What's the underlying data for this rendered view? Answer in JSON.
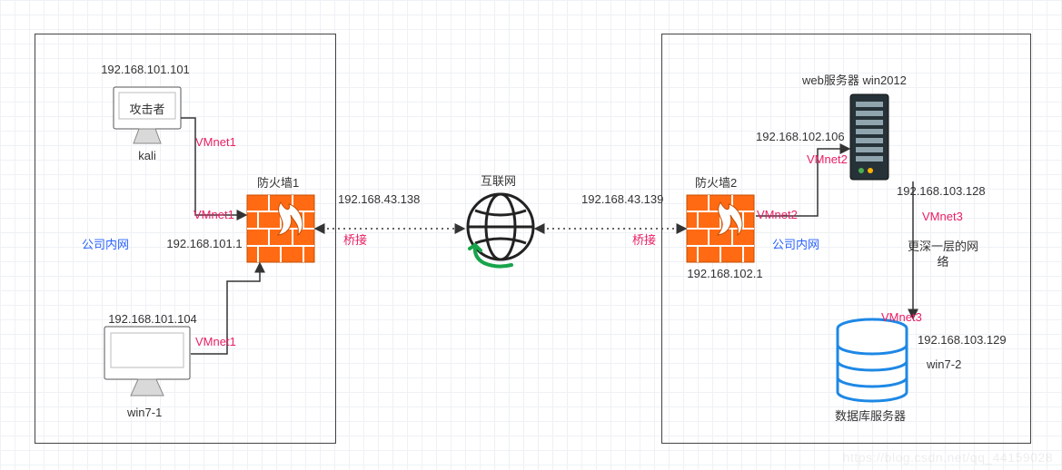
{
  "left_group": {
    "intranet_label": "公司内网",
    "attacker": {
      "ip": "192.168.101.101",
      "role": "攻击者",
      "name": "kali",
      "net": "VMnet1"
    },
    "win7": {
      "ip": "192.168.101.104",
      "name": "win7-1",
      "net": "VMnet1"
    },
    "firewall": {
      "title": "防火墙1",
      "lan_net": "VMnet1",
      "lan_ip": "192.168.101.1",
      "wan_ip": "192.168.43.138",
      "bridge": "桥接"
    }
  },
  "internet_label": "互联网",
  "right_group": {
    "intranet_label": "公司内网",
    "deeper_label": "更深一层的网络",
    "firewall": {
      "title": "防火墙2",
      "wan_ip": "192.168.43.139",
      "lan_net": "VMnet2",
      "lan_ip": "192.168.102.1",
      "bridge": "桥接"
    },
    "web": {
      "title": "web服务器 win2012",
      "net_in": "VMnet2",
      "ip_in": "192.168.102.106",
      "net_out": "VMnet3",
      "ip_out": "192.168.103.128"
    },
    "db": {
      "title": "数据库服务器",
      "net": "VMnet3",
      "ip": "192.168.103.129",
      "name": "win7-2"
    }
  },
  "watermark": "https://blog.csdn.net/qq_44159028"
}
